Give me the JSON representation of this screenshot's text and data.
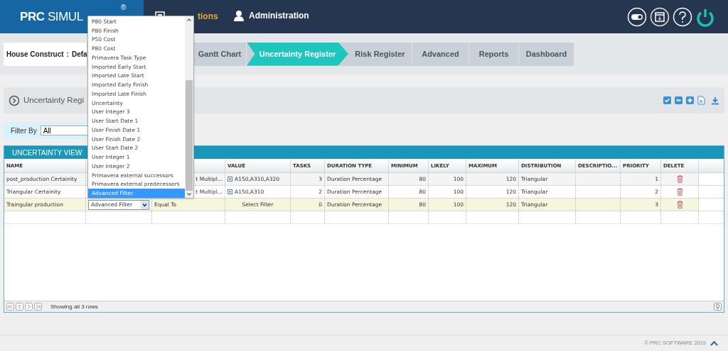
{
  "header": {
    "logo": "**PRC** SIMUL",
    "logo_mark": "®",
    "nav": [
      {
        "kind": "simulations",
        "label": "tions",
        "selected": true
      },
      {
        "kind": "administration",
        "label": "Administration",
        "selected": false
      }
    ]
  },
  "breadcrumb": {
    "project": "House Construct",
    "separator": ":",
    "scenario": "Defa"
  },
  "steps": [
    {
      "label": "Gantt Chart",
      "selected": false
    },
    {
      "label": "Uncertainty Register",
      "selected": true
    },
    {
      "label": "Risk Register",
      "selected": false
    },
    {
      "label": "Advanced",
      "selected": false
    },
    {
      "label": "Reports",
      "selected": false
    },
    {
      "label": "Dashboard",
      "selected": false
    }
  ],
  "panel": {
    "title": "Uncertainty Regi"
  },
  "filter": {
    "label": "Filter By",
    "value": "All"
  },
  "grid": {
    "title": "UNCERTAINTY VIEW",
    "columns": [
      "NAME",
      null,
      null,
      "VALUE",
      "TASKS",
      "DURATION TYPE",
      "MINIMUM",
      "LIKELY",
      "MAXIMUM",
      "DISTRIBUTION",
      "DESCRIPTIO...",
      "PRIORITY",
      "DELETE"
    ],
    "rows": [
      {
        "selected": false,
        "value_expandable": true,
        "cells": [
          "post_production Certainity",
          null,
          "t Multipl...",
          "A150,A310,A320",
          "3",
          "Duration Percentage",
          "80",
          "100",
          "120",
          "Triangular",
          null,
          "1"
        ]
      },
      {
        "selected": false,
        "value_expandable": true,
        "cells": [
          "Triangular Certainity",
          null,
          "t Multipl...",
          "A150,A310",
          "2",
          "Duration Percentage",
          "80",
          "100",
          "120",
          "Triangular",
          null,
          "2"
        ]
      },
      {
        "selected": true,
        "value_expandable": false,
        "cells": [
          "Traingular production",
          "Advanced Filter",
          "Equal To",
          "Select Filter",
          "0",
          "Duration Percentage",
          "80",
          "100",
          "120",
          "Triangular",
          null,
          "3"
        ]
      }
    ],
    "pager": {
      "status": "Showing all 3 rows"
    }
  },
  "dropdown": {
    "items": [
      {
        "label": "P80 Start",
        "selected": false
      },
      {
        "label": "P80 Finish",
        "selected": false
      },
      {
        "label": "P50 Cost",
        "selected": false
      },
      {
        "label": "P80 Cost",
        "selected": false
      },
      {
        "label": "Primavera Task Type",
        "selected": false
      },
      {
        "label": "Imported Early Start",
        "selected": false
      },
      {
        "label": "Imported Late Start",
        "selected": false
      },
      {
        "label": "Imported Early Finish",
        "selected": false
      },
      {
        "label": "Imported Late Finish",
        "selected": false
      },
      {
        "label": "Uncertainty",
        "selected": false
      },
      {
        "label": "User Integer 3",
        "selected": false
      },
      {
        "label": "User Start Date 1",
        "selected": false
      },
      {
        "label": "User Finish Date 1",
        "selected": false
      },
      {
        "label": "User Finish Date 2",
        "selected": false
      },
      {
        "label": "User Start Date 2",
        "selected": false
      },
      {
        "label": "User Integer 1",
        "selected": false
      },
      {
        "label": "User Integer 2",
        "selected": false
      },
      {
        "label": "Primavera external successors",
        "selected": false
      },
      {
        "label": "Primavera external predecessors",
        "selected": false
      },
      {
        "label": "Advanced Filter",
        "selected": true
      }
    ]
  },
  "footer": {
    "copyright": "© PRC SOFTWARE 2019"
  }
}
